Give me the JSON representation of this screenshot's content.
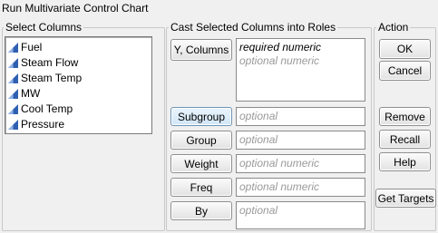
{
  "window": {
    "title": "Run Multivariate Control Chart"
  },
  "select_columns": {
    "label": "Select Columns",
    "items": [
      {
        "name": "Fuel"
      },
      {
        "name": "Steam Flow"
      },
      {
        "name": "Steam Temp"
      },
      {
        "name": "MW"
      },
      {
        "name": "Cool Temp"
      },
      {
        "name": "Pressure"
      }
    ]
  },
  "roles": {
    "label": "Cast Selected Columns into Roles",
    "y_columns": {
      "button": "Y, Columns",
      "line1": "required numeric",
      "line2": "optional numeric"
    },
    "subgroup": {
      "button": "Subgroup",
      "placeholder": "optional"
    },
    "group": {
      "button": "Group",
      "placeholder": "optional"
    },
    "weight": {
      "button": "Weight",
      "placeholder": "optional numeric"
    },
    "freq": {
      "button": "Freq",
      "placeholder": "optional numeric"
    },
    "by": {
      "button": "By",
      "placeholder": "optional"
    }
  },
  "action": {
    "label": "Action",
    "ok": "OK",
    "cancel": "Cancel",
    "remove": "Remove",
    "recall": "Recall",
    "help": "Help",
    "get_targets": "Get Targets"
  },
  "colors": {
    "icon_blue": "#2f5fb0",
    "selected_button": "#d1e6f7"
  },
  "icons": {
    "column_icon": "continuous-column-icon"
  }
}
